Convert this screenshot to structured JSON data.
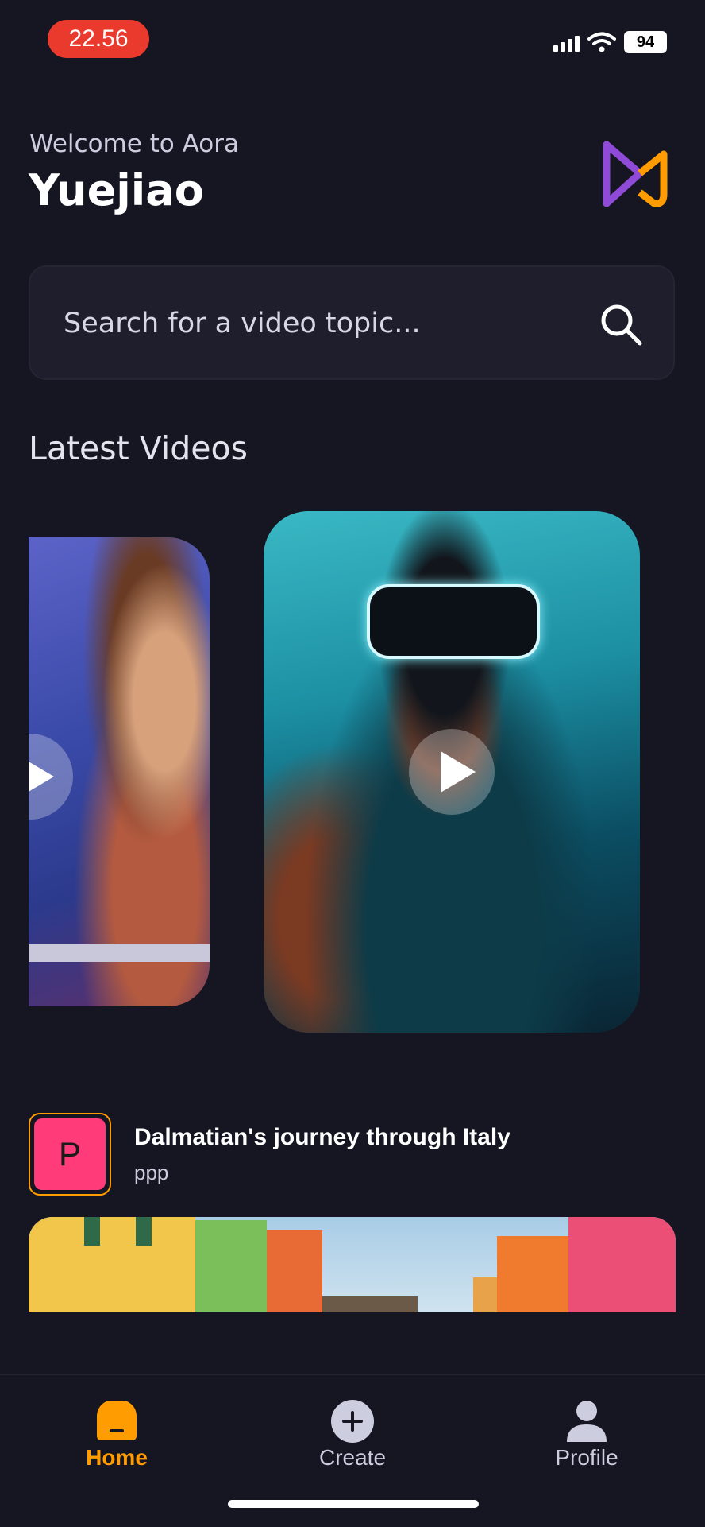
{
  "status_bar": {
    "time": "22.56",
    "battery": "94"
  },
  "header": {
    "welcome": "Welcome to Aora",
    "username": "Yuejiao",
    "logo_icon": "aora-logo-icon"
  },
  "search": {
    "placeholder": "Search for a video topic..."
  },
  "latest": {
    "title": "Latest Videos"
  },
  "post": {
    "avatar_letter": "P",
    "title": "Dalmatian's journey through Italy",
    "author": "ppp"
  },
  "tabs": [
    {
      "label": "Home",
      "icon": "home-icon",
      "active": true
    },
    {
      "label": "Create",
      "icon": "plus-circle-icon",
      "active": false
    },
    {
      "label": "Profile",
      "icon": "profile-icon",
      "active": false
    }
  ],
  "colors": {
    "accent": "#FF9C01",
    "background": "#161622",
    "search_bg": "#1E1E2D",
    "time_pill": "#EA3A2E",
    "avatar": "#FF3B7A"
  }
}
